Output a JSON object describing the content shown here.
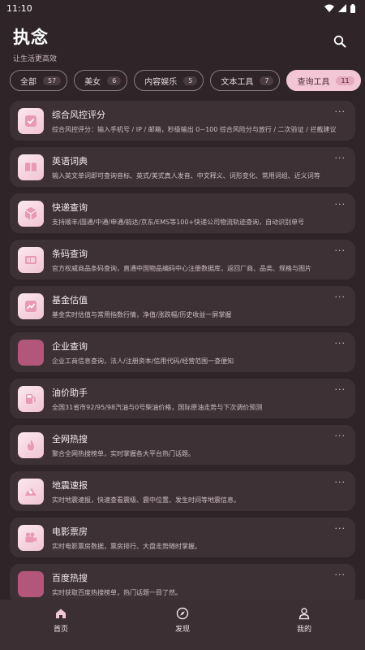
{
  "status_bar": {
    "time": "11:10"
  },
  "header": {
    "title": "执念",
    "subtitle": "让生活更高效"
  },
  "tabs": [
    {
      "label": "全部",
      "count": "57"
    },
    {
      "label": "美女",
      "count": "6"
    },
    {
      "label": "内容娱乐",
      "count": "5"
    },
    {
      "label": "文本工具",
      "count": "7"
    },
    {
      "label": "查询工具",
      "count": "11"
    }
  ],
  "cards": [
    {
      "title": "综合风控评分",
      "desc": "综合风控评分：输入手机号 / IP / 邮箱，秒级输出 0~100 综合风险分与放行 / 二次验证 / 拦截建议",
      "icon": "shield-check-icon"
    },
    {
      "title": "英语词典",
      "desc": "输入英文单词即可查询音标、英式/美式真人发音、中文释义、词形变化、常用词组、近义词等",
      "icon": "book-icon"
    },
    {
      "title": "快递查询",
      "desc": "支持顺丰/圆通/中通/申通/韵达/京东/EMS等100+快递公司物流轨迹查询，自动识别单号",
      "icon": "package-icon"
    },
    {
      "title": "条码查询",
      "desc": "官方权威商品条码查询，直通中国物品编码中心注册数据库，返回厂商、品类、规格与图片",
      "icon": "barcode-icon"
    },
    {
      "title": "基金估值",
      "desc": "基金实时估值与常用指数行情，净值/涨跌幅/历史收益一屏掌握",
      "icon": "trend-chart-icon"
    },
    {
      "title": "企业查询",
      "desc": "企业工商信息查询，法人/注册资本/信用代码/经营范围一查便知",
      "icon": ""
    },
    {
      "title": "油价助手",
      "desc": "全国31省市92/95/98汽油与0号柴油价格，国际原油走势与下次调价预测",
      "icon": "fuel-pump-icon"
    },
    {
      "title": "全网热搜",
      "desc": "聚合全网热搜榜单，实时掌握各大平台热门话题。",
      "icon": "flame-icon"
    },
    {
      "title": "地震速报",
      "desc": "实时地震速报，快速查看震级、震中位置、发生时间等地震信息。",
      "icon": "earthquake-icon"
    },
    {
      "title": "电影票房",
      "desc": "实时电影票房数据，票房排行、大盘走势随时掌握。",
      "icon": "film-camera-icon"
    },
    {
      "title": "百度热搜",
      "desc": "实时获取百度热搜榜单，热门话题一目了然。",
      "icon": ""
    }
  ],
  "nav": [
    {
      "label": "首页",
      "icon": "home-icon"
    },
    {
      "label": "发现",
      "icon": "compass-icon"
    },
    {
      "label": "我的",
      "icon": "person-icon"
    }
  ],
  "more_label": "···"
}
